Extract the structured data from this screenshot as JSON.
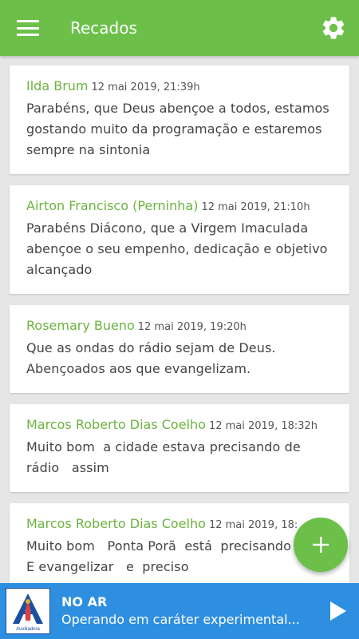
{
  "app_bar": {
    "title": "Recados",
    "menu_icon": "hamburger-menu-icon",
    "settings_icon": "gear-icon",
    "color": "#6cc04a"
  },
  "messages": [
    {
      "author": "Ilda Brum",
      "timestamp": "12 mai 2019, 21:39h",
      "text": "Parabéns, que Deus abençoe a todos, estamos\ngostando muito da programação e estaremos\nsempre na sintonia"
    },
    {
      "author": "Airton Francisco (Perninha)",
      "timestamp": "12 mai 2019, 21:10h",
      "text": "Parabéns Diácono, que a Virgem Imaculada\nabençoe o seu empenho, dedicação e objetivo\nalcançado"
    },
    {
      "author": "Rosemary Bueno",
      "timestamp": "12 mai 2019, 19:20h",
      "text": "Que as ondas do rádio sejam de Deus.\nAbençoados aos que evangelizam."
    },
    {
      "author": "Marcos Roberto Dias Coelho",
      "timestamp": "12 mai 2019, 18:32h",
      "text": "Muito bom  a cidade estava precisando de\nrádio   assim"
    },
    {
      "author": "Marcos Roberto Dias Coelho",
      "timestamp": "12 mai 2019, 18:",
      "text": "Muito bom   Ponta Porã  está  precisando\nE evangelizar   e  preciso"
    }
  ],
  "fab": {
    "icon": "plus-icon"
  },
  "player": {
    "title": "NO AR",
    "subtitle": "Operando em caráter experimental...",
    "logo_icon": "radio-station-logo-icon",
    "logo_caption": "Auxiliadora",
    "play_icon": "play-icon",
    "color": "#2e8fe0"
  }
}
